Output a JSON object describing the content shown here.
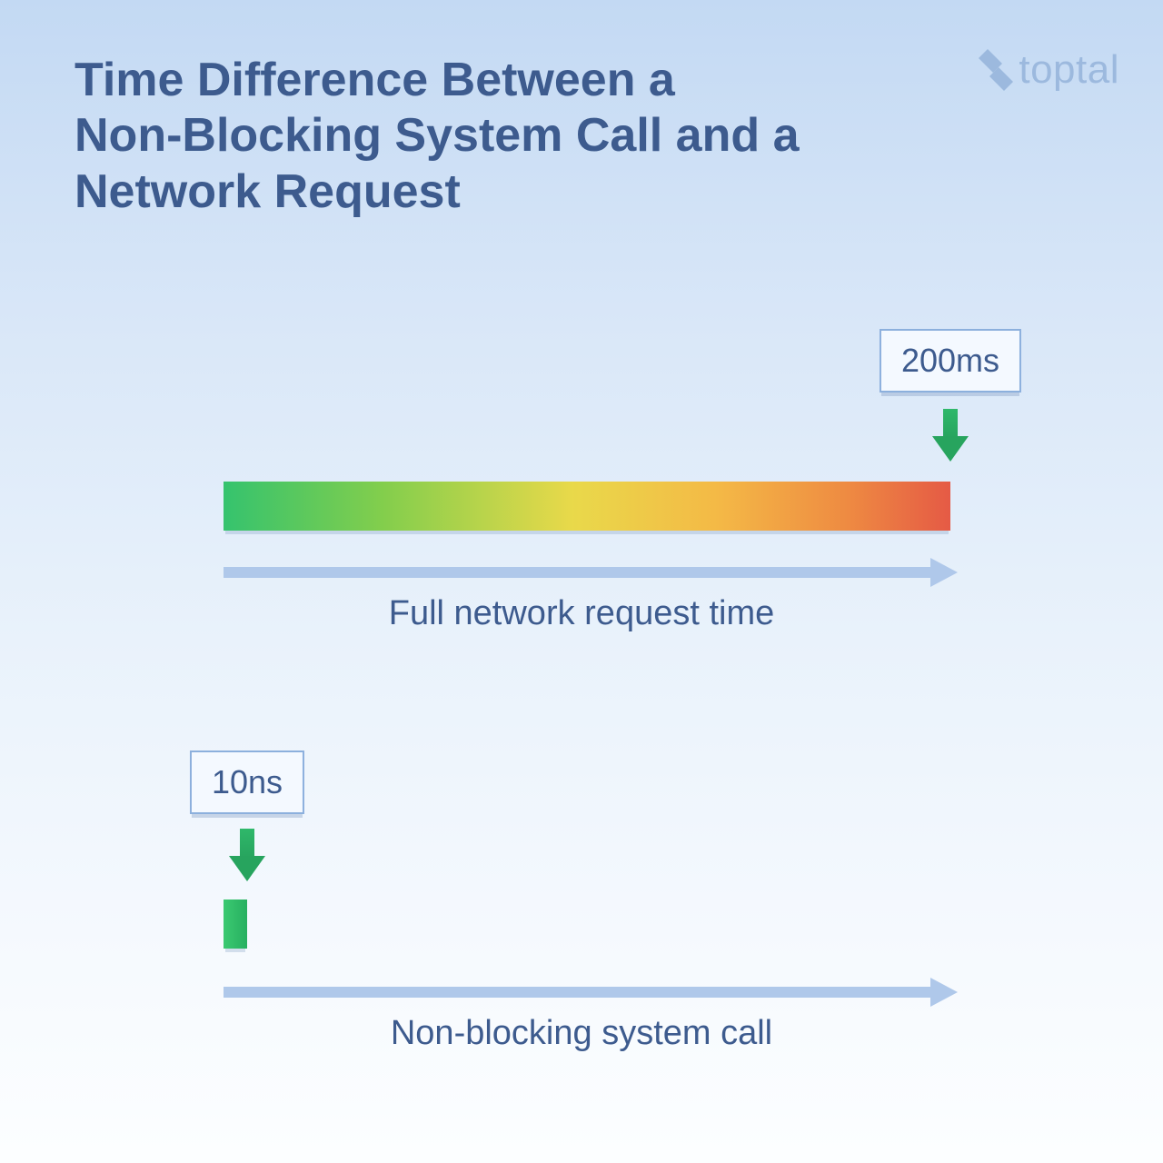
{
  "title": "Time Difference Between a Non‑Blocking System Call and a Network Request",
  "brand": "toptal",
  "network": {
    "badge": "200ms",
    "caption": "Full network request time"
  },
  "syscall": {
    "badge": "10ns",
    "caption": "Non‑blocking system call"
  },
  "chart_data": {
    "type": "bar",
    "title": "Time Difference Between a Non‑Blocking System Call and a Network Request",
    "series": [
      {
        "name": "Full network request time",
        "label": "200ms",
        "value_ns": 200000000
      },
      {
        "name": "Non‑blocking system call",
        "label": "10ns",
        "value_ns": 10
      }
    ],
    "xlabel": "time",
    "ylabel": ""
  }
}
